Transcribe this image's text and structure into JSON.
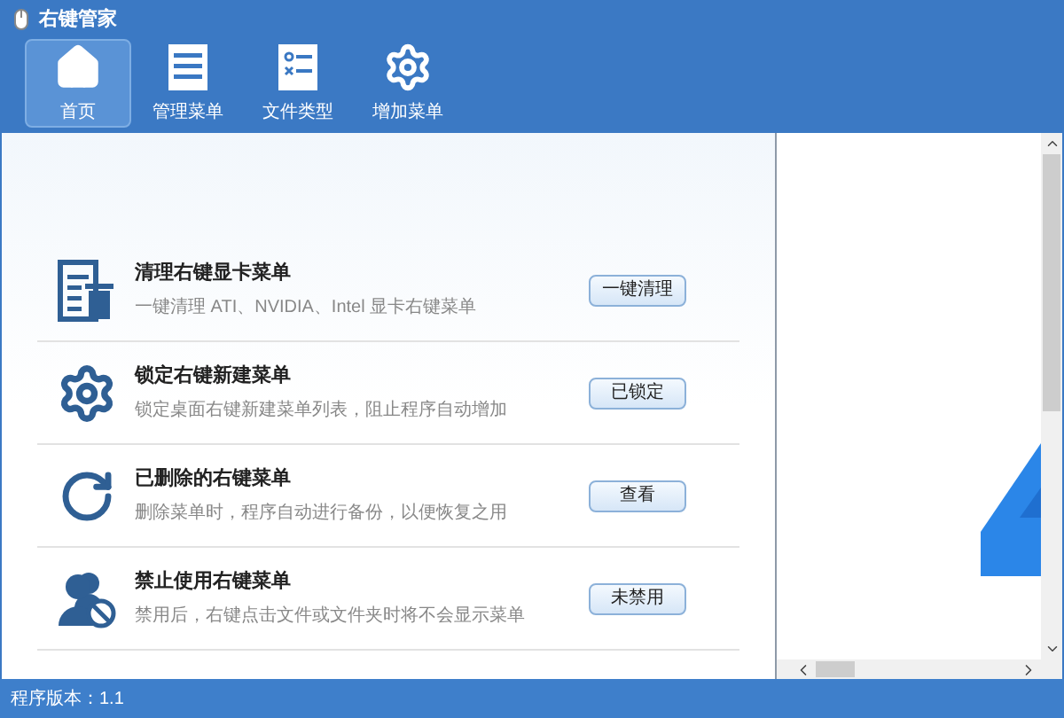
{
  "window": {
    "title": "右键管家"
  },
  "tabs": [
    {
      "label": "首页",
      "kind": "home",
      "selected": true
    },
    {
      "label": "管理菜单",
      "kind": "list",
      "selected": false
    },
    {
      "label": "文件类型",
      "kind": "filetype",
      "selected": false
    },
    {
      "label": "增加菜单",
      "kind": "gear",
      "selected": false
    }
  ],
  "features": [
    {
      "kind": "clean",
      "title": "清理右键显卡菜单",
      "description": "一键清理 ATI、NVIDIA、Intel 显卡右键菜单",
      "button": "一键清理"
    },
    {
      "kind": "lock",
      "title": "锁定右键新建菜单",
      "description": "锁定桌面右键新建菜单列表，阻止程序自动增加",
      "button": "已锁定"
    },
    {
      "kind": "restore",
      "title": "已删除的右键菜单",
      "description": "删除菜单时，程序自动进行备份，以便恢复之用",
      "button": "查看"
    },
    {
      "kind": "disable",
      "title": "禁止使用右键菜单",
      "description": "禁用后，右键点击文件或文件夹时将不会显示菜单",
      "button": "未禁用"
    }
  ],
  "status_bar": {
    "text": "程序版本：1.1"
  }
}
